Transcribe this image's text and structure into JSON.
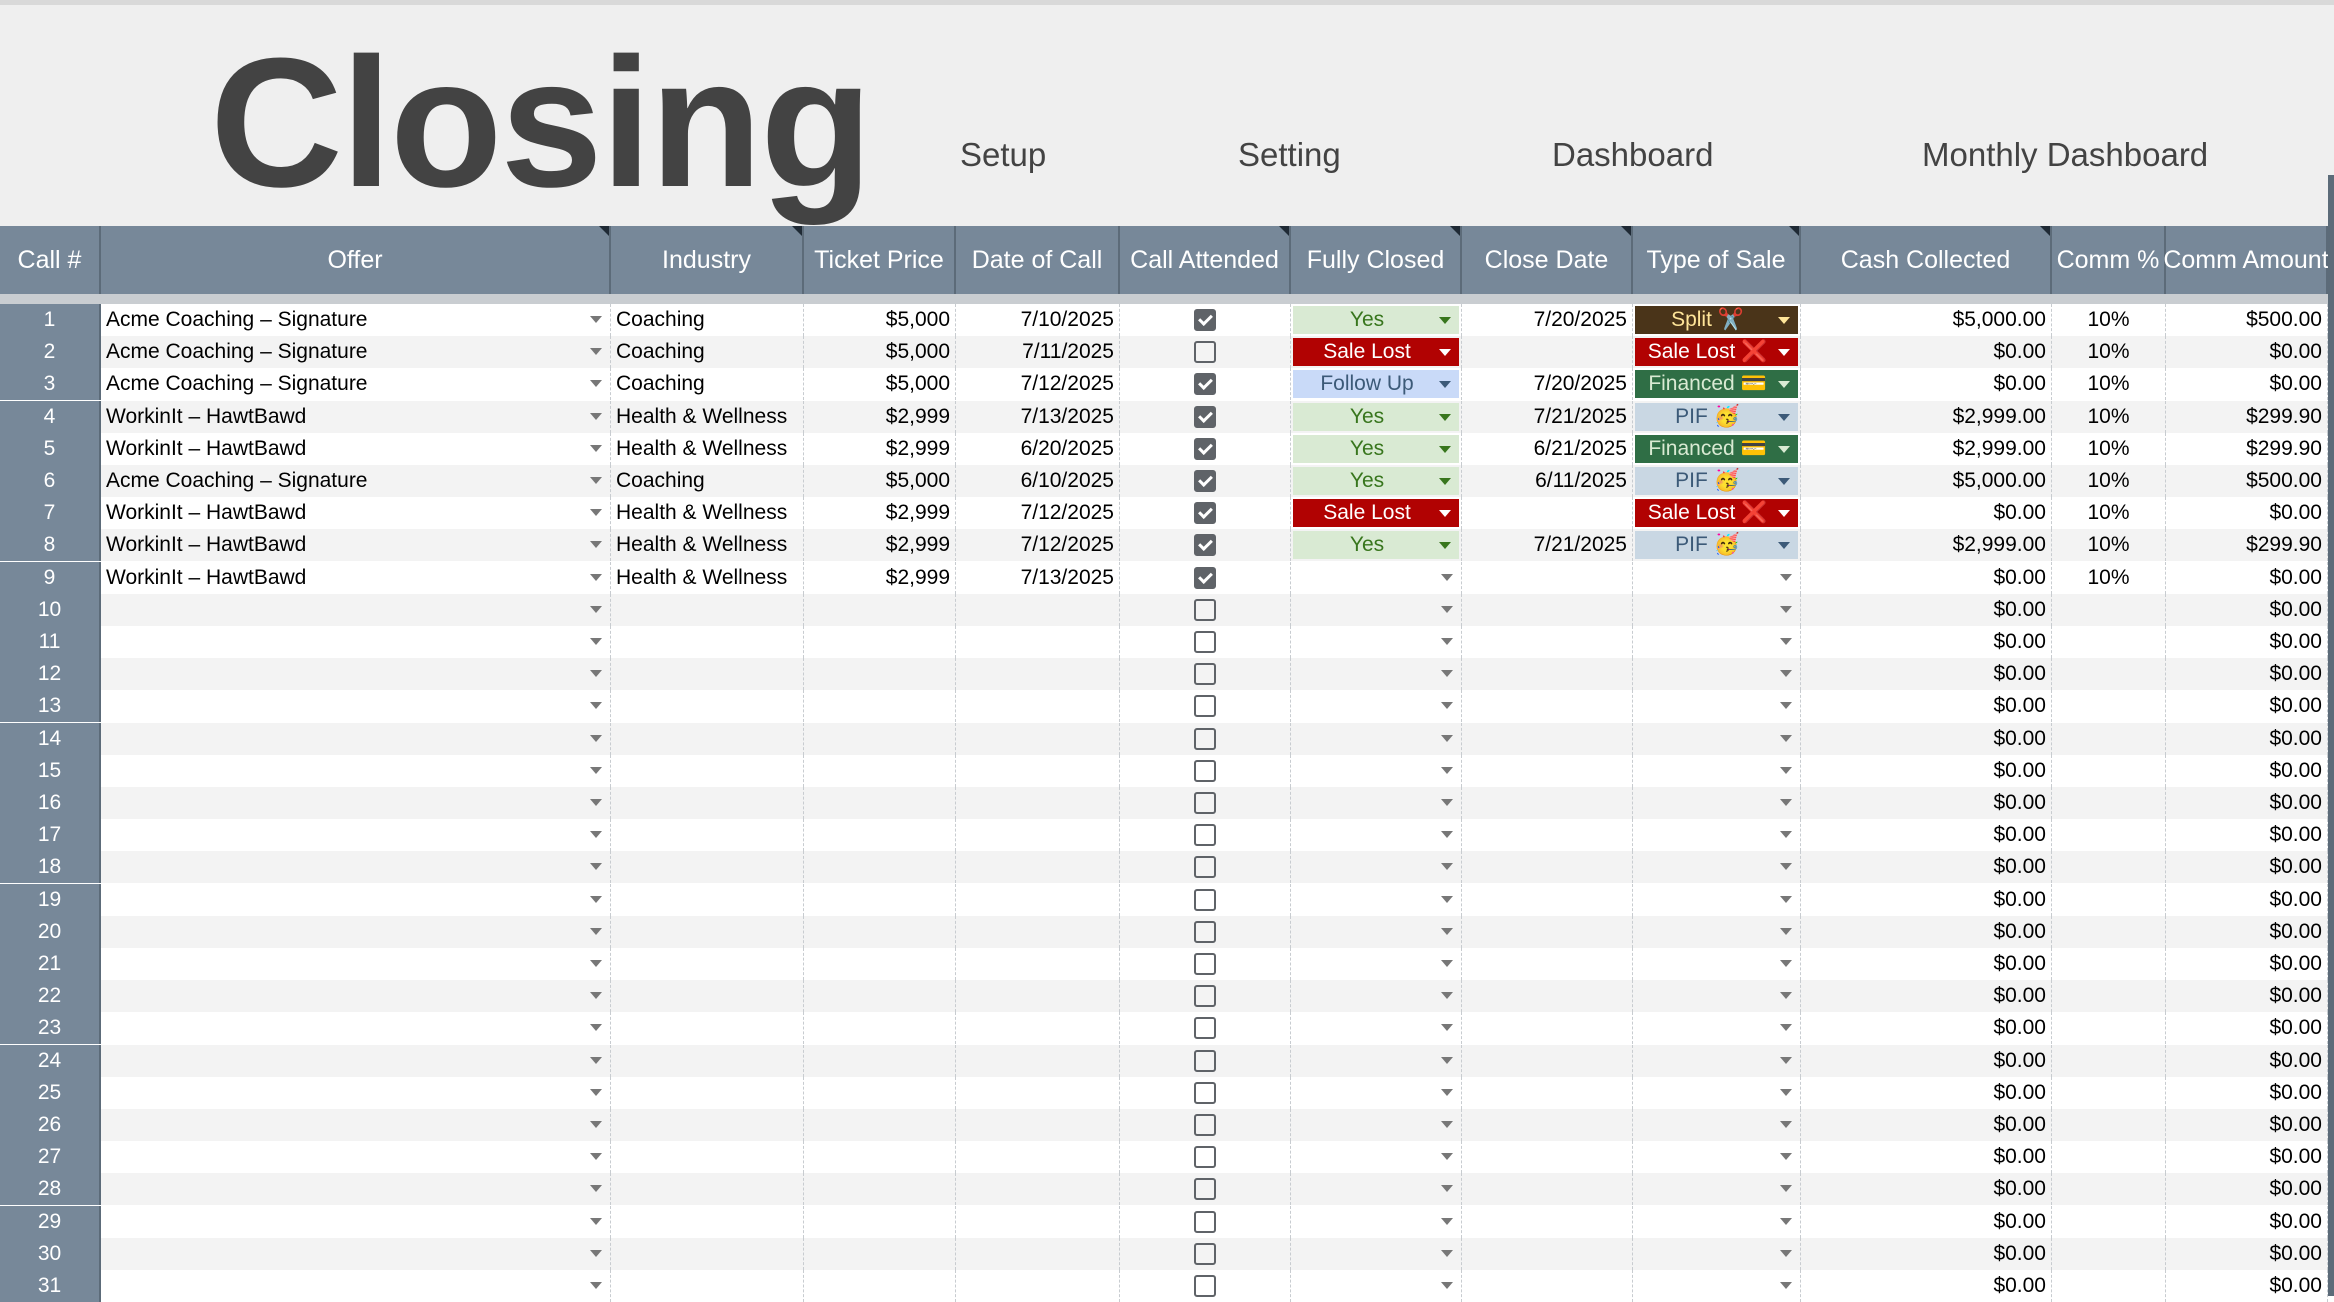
{
  "title": "Closing",
  "nav": [
    "Setup",
    "Setting",
    "Dashboard",
    "Monthly Dashboard"
  ],
  "columns": [
    "Call #",
    "Offer",
    "Industry",
    "Ticket Price",
    "Date of Call",
    "Call Attended",
    "Fully Closed",
    "Close Date",
    "Type of Sale",
    "Cash Collected",
    "Comm %",
    "Comm Amount"
  ],
  "rows": [
    {
      "n": "1",
      "offer": "Acme Coaching – Signature",
      "industry": "Coaching",
      "price": "$5,000",
      "date": "7/10/2025",
      "attended": true,
      "closed": "Yes",
      "closeDate": "7/20/2025",
      "sale": "Split ✂️",
      "cash": "$5,000.00",
      "pct": "10%",
      "amount": "$500.00"
    },
    {
      "n": "2",
      "offer": "Acme Coaching – Signature",
      "industry": "Coaching",
      "price": "$5,000",
      "date": "7/11/2025",
      "attended": false,
      "closed": "Sale Lost",
      "closeDate": "",
      "sale": "Sale Lost ❌",
      "cash": "$0.00",
      "pct": "10%",
      "amount": "$0.00"
    },
    {
      "n": "3",
      "offer": "Acme Coaching – Signature",
      "industry": "Coaching",
      "price": "$5,000",
      "date": "7/12/2025",
      "attended": true,
      "closed": "Follow Up",
      "closeDate": "7/20/2025",
      "sale": "Financed 💳",
      "cash": "$0.00",
      "pct": "10%",
      "amount": "$0.00"
    },
    {
      "n": "4",
      "offer": "WorkinIt – HawtBawd",
      "industry": "Health & Wellness",
      "price": "$2,999",
      "date": "7/13/2025",
      "attended": true,
      "closed": "Yes",
      "closeDate": "7/21/2025",
      "sale": "PIF 🥳",
      "cash": "$2,999.00",
      "pct": "10%",
      "amount": "$299.90"
    },
    {
      "n": "5",
      "offer": "WorkinIt – HawtBawd",
      "industry": "Health & Wellness",
      "price": "$2,999",
      "date": "6/20/2025",
      "attended": true,
      "closed": "Yes",
      "closeDate": "6/21/2025",
      "sale": "Financed 💳",
      "cash": "$2,999.00",
      "pct": "10%",
      "amount": "$299.90"
    },
    {
      "n": "6",
      "offer": "Acme Coaching – Signature",
      "industry": "Coaching",
      "price": "$5,000",
      "date": "6/10/2025",
      "attended": true,
      "closed": "Yes",
      "closeDate": "6/11/2025",
      "sale": "PIF 🥳",
      "cash": "$5,000.00",
      "pct": "10%",
      "amount": "$500.00"
    },
    {
      "n": "7",
      "offer": "WorkinIt – HawtBawd",
      "industry": "Health & Wellness",
      "price": "$2,999",
      "date": "7/12/2025",
      "attended": true,
      "closed": "Sale Lost",
      "closeDate": "",
      "sale": "Sale Lost ❌",
      "cash": "$0.00",
      "pct": "10%",
      "amount": "$0.00"
    },
    {
      "n": "8",
      "offer": "WorkinIt – HawtBawd",
      "industry": "Health & Wellness",
      "price": "$2,999",
      "date": "7/12/2025",
      "attended": true,
      "closed": "Yes",
      "closeDate": "7/21/2025",
      "sale": "PIF 🥳",
      "cash": "$2,999.00",
      "pct": "10%",
      "amount": "$299.90"
    },
    {
      "n": "9",
      "offer": "WorkinIt – HawtBawd",
      "industry": "Health & Wellness",
      "price": "$2,999",
      "date": "7/13/2025",
      "attended": true,
      "closed": "",
      "closeDate": "",
      "sale": "",
      "cash": "$0.00",
      "pct": "10%",
      "amount": "$0.00"
    },
    {
      "n": "10",
      "offer": "",
      "industry": "",
      "price": "",
      "date": "",
      "attended": false,
      "closed": "",
      "closeDate": "",
      "sale": "",
      "cash": "$0.00",
      "pct": "",
      "amount": "$0.00"
    },
    {
      "n": "11",
      "offer": "",
      "industry": "",
      "price": "",
      "date": "",
      "attended": false,
      "closed": "",
      "closeDate": "",
      "sale": "",
      "cash": "$0.00",
      "pct": "",
      "amount": "$0.00"
    },
    {
      "n": "12",
      "offer": "",
      "industry": "",
      "price": "",
      "date": "",
      "attended": false,
      "closed": "",
      "closeDate": "",
      "sale": "",
      "cash": "$0.00",
      "pct": "",
      "amount": "$0.00"
    },
    {
      "n": "13",
      "offer": "",
      "industry": "",
      "price": "",
      "date": "",
      "attended": false,
      "closed": "",
      "closeDate": "",
      "sale": "",
      "cash": "$0.00",
      "pct": "",
      "amount": "$0.00"
    },
    {
      "n": "14",
      "offer": "",
      "industry": "",
      "price": "",
      "date": "",
      "attended": false,
      "closed": "",
      "closeDate": "",
      "sale": "",
      "cash": "$0.00",
      "pct": "",
      "amount": "$0.00"
    },
    {
      "n": "15",
      "offer": "",
      "industry": "",
      "price": "",
      "date": "",
      "attended": false,
      "closed": "",
      "closeDate": "",
      "sale": "",
      "cash": "$0.00",
      "pct": "",
      "amount": "$0.00"
    },
    {
      "n": "16",
      "offer": "",
      "industry": "",
      "price": "",
      "date": "",
      "attended": false,
      "closed": "",
      "closeDate": "",
      "sale": "",
      "cash": "$0.00",
      "pct": "",
      "amount": "$0.00"
    },
    {
      "n": "17",
      "offer": "",
      "industry": "",
      "price": "",
      "date": "",
      "attended": false,
      "closed": "",
      "closeDate": "",
      "sale": "",
      "cash": "$0.00",
      "pct": "",
      "amount": "$0.00"
    },
    {
      "n": "18",
      "offer": "",
      "industry": "",
      "price": "",
      "date": "",
      "attended": false,
      "closed": "",
      "closeDate": "",
      "sale": "",
      "cash": "$0.00",
      "pct": "",
      "amount": "$0.00"
    },
    {
      "n": "19",
      "offer": "",
      "industry": "",
      "price": "",
      "date": "",
      "attended": false,
      "closed": "",
      "closeDate": "",
      "sale": "",
      "cash": "$0.00",
      "pct": "",
      "amount": "$0.00"
    },
    {
      "n": "20",
      "offer": "",
      "industry": "",
      "price": "",
      "date": "",
      "attended": false,
      "closed": "",
      "closeDate": "",
      "sale": "",
      "cash": "$0.00",
      "pct": "",
      "amount": "$0.00"
    },
    {
      "n": "21",
      "offer": "",
      "industry": "",
      "price": "",
      "date": "",
      "attended": false,
      "closed": "",
      "closeDate": "",
      "sale": "",
      "cash": "$0.00",
      "pct": "",
      "amount": "$0.00"
    },
    {
      "n": "22",
      "offer": "",
      "industry": "",
      "price": "",
      "date": "",
      "attended": false,
      "closed": "",
      "closeDate": "",
      "sale": "",
      "cash": "$0.00",
      "pct": "",
      "amount": "$0.00"
    },
    {
      "n": "23",
      "offer": "",
      "industry": "",
      "price": "",
      "date": "",
      "attended": false,
      "closed": "",
      "closeDate": "",
      "sale": "",
      "cash": "$0.00",
      "pct": "",
      "amount": "$0.00"
    },
    {
      "n": "24",
      "offer": "",
      "industry": "",
      "price": "",
      "date": "",
      "attended": false,
      "closed": "",
      "closeDate": "",
      "sale": "",
      "cash": "$0.00",
      "pct": "",
      "amount": "$0.00"
    },
    {
      "n": "25",
      "offer": "",
      "industry": "",
      "price": "",
      "date": "",
      "attended": false,
      "closed": "",
      "closeDate": "",
      "sale": "",
      "cash": "$0.00",
      "pct": "",
      "amount": "$0.00"
    },
    {
      "n": "26",
      "offer": "",
      "industry": "",
      "price": "",
      "date": "",
      "attended": false,
      "closed": "",
      "closeDate": "",
      "sale": "",
      "cash": "$0.00",
      "pct": "",
      "amount": "$0.00"
    },
    {
      "n": "27",
      "offer": "",
      "industry": "",
      "price": "",
      "date": "",
      "attended": false,
      "closed": "",
      "closeDate": "",
      "sale": "",
      "cash": "$0.00",
      "pct": "",
      "amount": "$0.00"
    },
    {
      "n": "28",
      "offer": "",
      "industry": "",
      "price": "",
      "date": "",
      "attended": false,
      "closed": "",
      "closeDate": "",
      "sale": "",
      "cash": "$0.00",
      "pct": "",
      "amount": "$0.00"
    },
    {
      "n": "29",
      "offer": "",
      "industry": "",
      "price": "",
      "date": "",
      "attended": false,
      "closed": "",
      "closeDate": "",
      "sale": "",
      "cash": "$0.00",
      "pct": "",
      "amount": "$0.00"
    },
    {
      "n": "30",
      "offer": "",
      "industry": "",
      "price": "",
      "date": "",
      "attended": false,
      "closed": "",
      "closeDate": "",
      "sale": "",
      "cash": "$0.00",
      "pct": "",
      "amount": "$0.00"
    },
    {
      "n": "31",
      "offer": "",
      "industry": "",
      "price": "",
      "date": "",
      "attended": false,
      "closed": "",
      "closeDate": "",
      "sale": "",
      "cash": "$0.00",
      "pct": "",
      "amount": "$0.00"
    }
  ],
  "chipStyles": {
    "Yes": {
      "bg": "#d9ead3",
      "fg": "#38761d"
    },
    "Sale Lost": {
      "bg": "#b10202",
      "fg": "#ffffff"
    },
    "Follow Up": {
      "bg": "#c9daf8",
      "fg": "#3c5a78"
    },
    "Split ✂️": {
      "bg": "#4a3419",
      "fg": "#ffe599"
    },
    "Sale Lost ❌": {
      "bg": "#b10202",
      "fg": "#ffffff"
    },
    "Financed 💳": {
      "bg": "#2f6e45",
      "fg": "#d9ead3"
    },
    "PIF 🥳": {
      "bg": "#c9d7e3",
      "fg": "#3c5a78"
    }
  },
  "colors": {
    "header": "#778899",
    "title": "#434343",
    "banner": "#efefef"
  }
}
